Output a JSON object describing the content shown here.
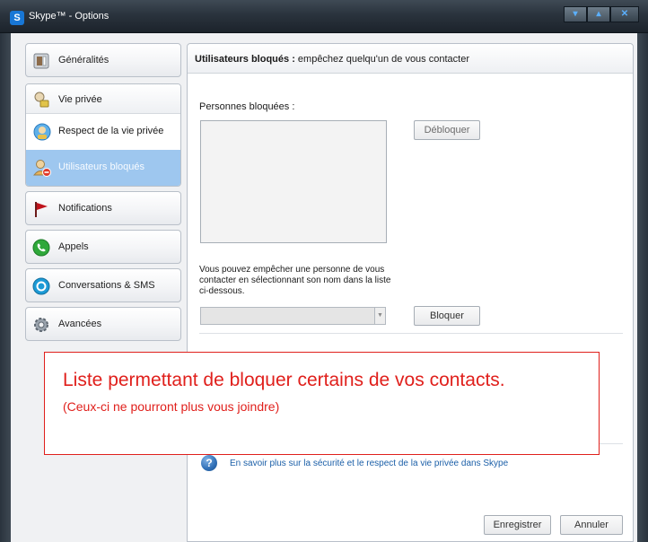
{
  "window": {
    "title": "Skype™ - Options",
    "controls": [
      "minimize",
      "maximize",
      "close"
    ]
  },
  "sidebar": {
    "items": [
      {
        "label": "Généralités",
        "icon": "general-icon"
      },
      {
        "label": "Vie privée",
        "icon": "privacy-icon"
      },
      {
        "label": "Respect de la vie privée",
        "icon": "privacy-settings-icon"
      },
      {
        "label": "Utilisateurs bloqués",
        "icon": "blocked-users-icon",
        "selected": true
      },
      {
        "label": "Notifications",
        "icon": "flag-icon"
      },
      {
        "label": "Appels",
        "icon": "phone-icon"
      },
      {
        "label": "Conversations & SMS",
        "icon": "chat-icon"
      },
      {
        "label": "Avancées",
        "icon": "gear-icon"
      }
    ]
  },
  "panel": {
    "header_bold": "Utilisateurs bloqués :",
    "header_rest": " empêchez quelqu'un de vous contacter",
    "blocked_label": "Personnes bloquées :",
    "unblock_button": "Débloquer",
    "description": "Vous pouvez empêcher une personne de vous contacter en sélectionnant son nom dans la liste ci-dessous.",
    "block_button": "Bloquer",
    "help_link": "En savoir plus sur la sécurité et le respect de la vie privée dans Skype",
    "save_button": "Enregistrer",
    "cancel_button": "Annuler"
  },
  "annotation": {
    "line1": "Liste permettant de bloquer certains de vos contacts.",
    "line2": "(Ceux-ci ne pourront plus vous joindre)"
  },
  "colors": {
    "selected_bg": "#9ec7ef",
    "annotation_red": "#e0201c",
    "link_blue": "#1b5fa8"
  }
}
